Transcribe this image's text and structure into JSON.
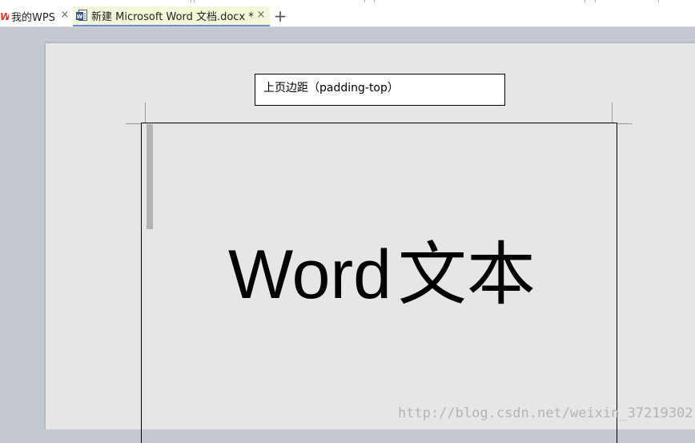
{
  "tabs": {
    "my_wps": {
      "label": "我的WPS",
      "logo_text": "W"
    },
    "document": {
      "label": "新建 Microsoft Word 文档.docx *"
    },
    "close_glyph": "×",
    "new_tab_glyph": "+"
  },
  "page": {
    "callout": "上页边距（padding-top）",
    "body_text_latin": "Word",
    "body_text_cjk": "文本"
  },
  "watermark": "http://blog.csdn.net/weixin_37219302",
  "colors": {
    "workspace_bg": "#c4c8d0",
    "page_bg": "#e6e6e6",
    "active_tab_bg": "#f5f7d9",
    "active_tab_underline": "#6b8fd6",
    "wps_logo": "#e0352b"
  }
}
